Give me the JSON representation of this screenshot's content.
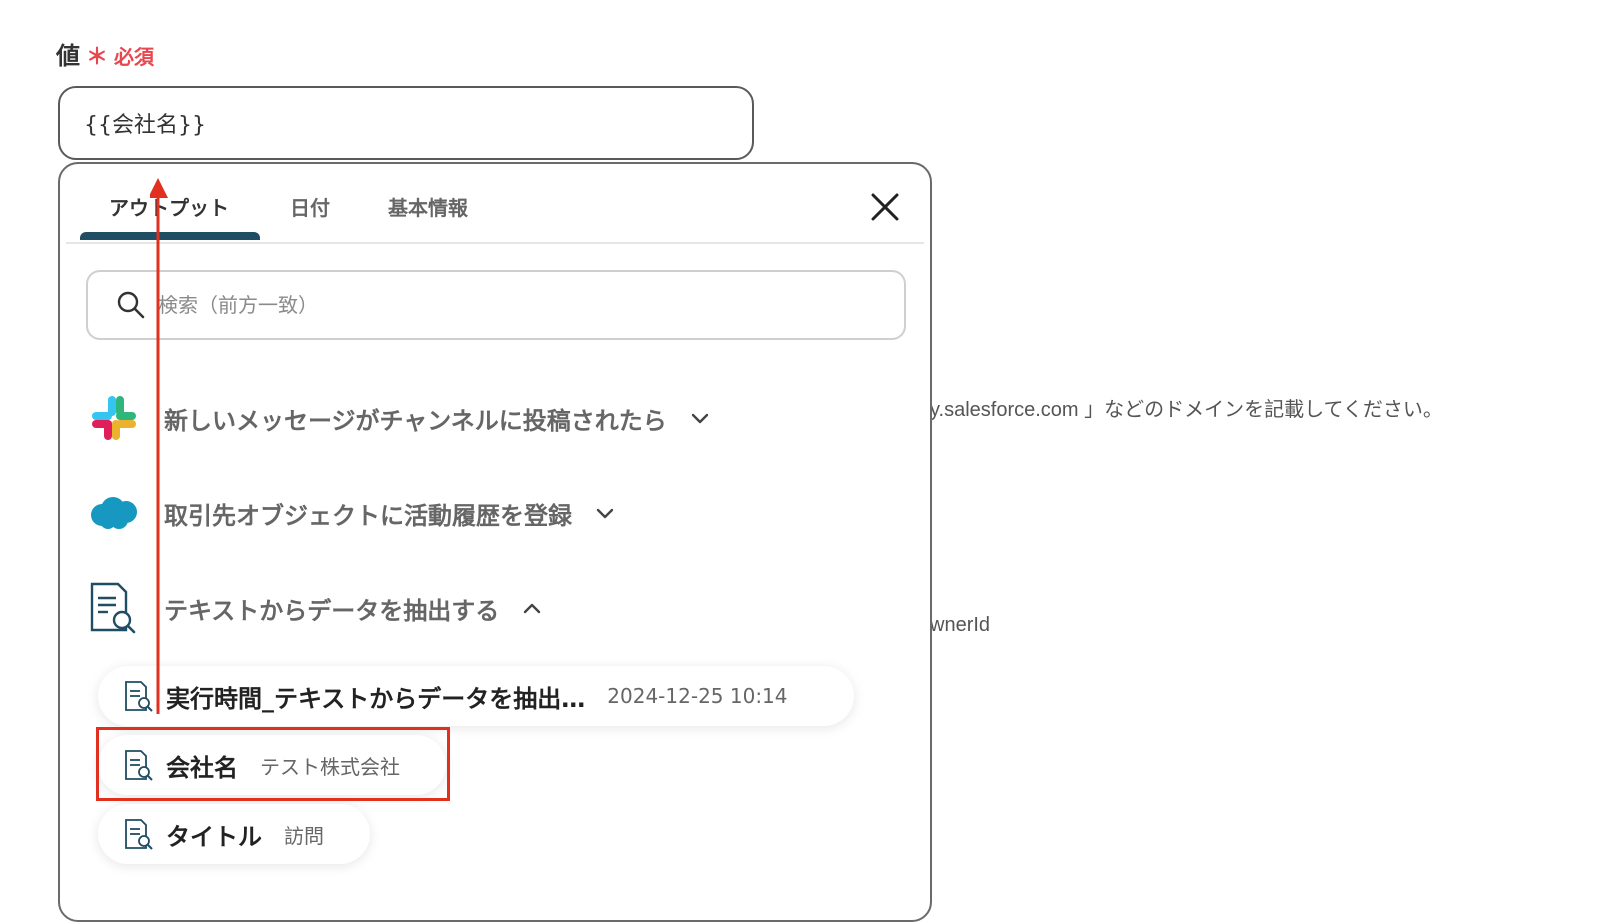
{
  "field": {
    "label": "値",
    "required_mark": "＊",
    "required_label": "必須",
    "value": "{{会社名}}"
  },
  "background": {
    "domain_hint": "y.salesforce.com 」などのドメインを記載してください。",
    "owner_field": "wnerId"
  },
  "panel": {
    "tabs": [
      {
        "label": "アウトプット",
        "active": true
      },
      {
        "label": "日付",
        "active": false
      },
      {
        "label": "基本情報",
        "active": false
      }
    ],
    "close_icon": "close-icon",
    "search": {
      "placeholder": "検索（前方一致）",
      "value": ""
    },
    "groups": [
      {
        "label": "新しいメッセージがチャンネルに投稿されたら",
        "icon": "slack-icon",
        "expanded": false
      },
      {
        "label": "取引先オブジェクトに活動履歴を登録",
        "icon": "salesforce-cloud-icon",
        "expanded": false
      },
      {
        "label": "テキストからデータを抽出する",
        "icon": "document-search-icon",
        "expanded": true
      }
    ],
    "items": [
      {
        "name": "実行時間_テキストからデータを抽出…",
        "value": "2024-12-25 10:14"
      },
      {
        "name": "会社名",
        "value": "テスト株式会社"
      },
      {
        "name": "タイトル",
        "value": "訪問"
      }
    ]
  },
  "colors": {
    "highlight": "#e1301f",
    "tab_underline": "#1f4d63",
    "required": "#e8474f"
  }
}
